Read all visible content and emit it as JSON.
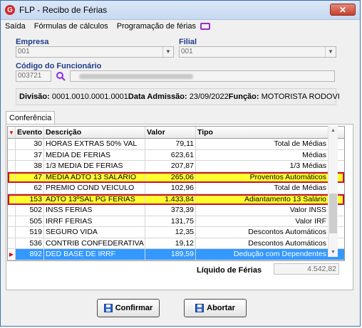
{
  "window": {
    "title": "FLP - Recibo de Férias",
    "app_icon_letter": "G",
    "close_glyph": "✕"
  },
  "menu": {
    "items": [
      "Saída",
      "Fórmulas de cálculos",
      "Programação de férias"
    ],
    "extra_icon": "monitor-icon"
  },
  "empresa": {
    "label": "Empresa",
    "value": "001"
  },
  "filial": {
    "label": "Filial",
    "value": "001"
  },
  "funcionario": {
    "label": "Código do Funcionário",
    "code": "003721"
  },
  "info": {
    "divisao_label": "Divisão:",
    "divisao_value": "0001.0010.0001.0001",
    "admissao_label": "Data Admissão:",
    "admissao_value": "23/09/2022",
    "funcao_label": "Função:",
    "funcao_value": "MOTORISTA RODOVI"
  },
  "tab": {
    "label": "Conferência"
  },
  "grid": {
    "headers": {
      "evento": "Evento",
      "descricao": "Descrição",
      "valor": "Valor",
      "tipo": "Tipo"
    },
    "rows": [
      {
        "evento": "30",
        "descricao": "HORAS EXTRAS 50% VAL",
        "valor": "79,11",
        "tipo": "Total de Médias"
      },
      {
        "evento": "37",
        "descricao": "MEDIA DE FERIAS",
        "valor": "623,61",
        "tipo": "Médias"
      },
      {
        "evento": "38",
        "descricao": "1/3 MEDIA DE FERIAS",
        "valor": "207,87",
        "tipo": "1/3 Médias"
      },
      {
        "evento": "47",
        "descricao": "MEDIA ADTO 13 SALARIO",
        "valor": "265,06",
        "tipo": "Proventos Automáticos"
      },
      {
        "evento": "62",
        "descricao": "PREMIO COND VEICULO",
        "valor": "102,96",
        "tipo": "Total de Médias"
      },
      {
        "evento": "153",
        "descricao": "ADTO 13ºSAL PG FERIAS",
        "valor": "1.433,84",
        "tipo": "Adiantamento 13 Salário"
      },
      {
        "evento": "502",
        "descricao": "INSS FERIAS",
        "valor": "373,39",
        "tipo": "Valor INSS"
      },
      {
        "evento": "505",
        "descricao": "IRRF FERIAS",
        "valor": "131,75",
        "tipo": "Valor IRF"
      },
      {
        "evento": "519",
        "descricao": "SEGURO VIDA",
        "valor": "12,35",
        "tipo": "Descontos Automáticos"
      },
      {
        "evento": "536",
        "descricao": "CONTRIB CONFEDERATIVA",
        "valor": "19,12",
        "tipo": "Descontos Automáticos"
      },
      {
        "evento": "892",
        "descricao": "DED BASE DE IRRF",
        "valor": "189,59",
        "tipo": "Dedução com Dependentes"
      }
    ]
  },
  "liquido": {
    "label": "Líquido de Férias",
    "value": "4.542,82"
  },
  "buttons": {
    "confirmar": "Confirmar",
    "abortar": "Abortar"
  },
  "colors": {
    "highlight": "#ffff2e",
    "highlight_border": "#c8102e",
    "selected": "#3399ff",
    "label_blue": "#1f3c88"
  }
}
